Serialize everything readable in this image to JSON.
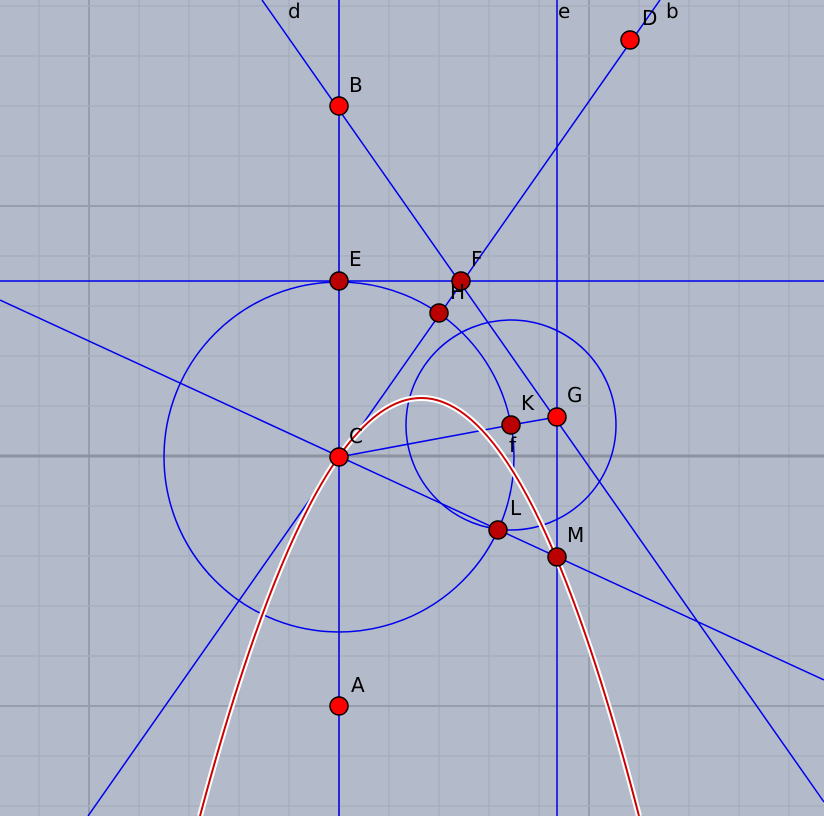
{
  "colors": {
    "background": "#b3bac9",
    "grid_minor": "#a7aebd",
    "grid_major": "#969dab",
    "axis": "#8c929e",
    "construction": "#0000ee",
    "curve_outer": "#ffffff",
    "curve_inner": "#cc0000",
    "point_free": "#ff0000",
    "point_dependent": "#bb0000",
    "point_stroke": "#000000"
  },
  "points": [
    {
      "id": "A",
      "label": "A",
      "kind": "free"
    },
    {
      "id": "B",
      "label": "B",
      "kind": "free"
    },
    {
      "id": "C",
      "label": "C",
      "kind": "free"
    },
    {
      "id": "D",
      "label": "D",
      "kind": "free"
    },
    {
      "id": "E",
      "label": "E",
      "kind": "dependent"
    },
    {
      "id": "F",
      "label": "F",
      "kind": "dependent"
    },
    {
      "id": "G",
      "label": "G",
      "kind": "free"
    },
    {
      "id": "H",
      "label": "H",
      "kind": "dependent"
    },
    {
      "id": "K",
      "label": "K",
      "kind": "dependent"
    },
    {
      "id": "L",
      "label": "L",
      "kind": "dependent"
    },
    {
      "id": "M",
      "label": "M",
      "kind": "dependent"
    }
  ],
  "line_labels": {
    "d": "d",
    "e": "e",
    "b": "b",
    "f": "f"
  }
}
